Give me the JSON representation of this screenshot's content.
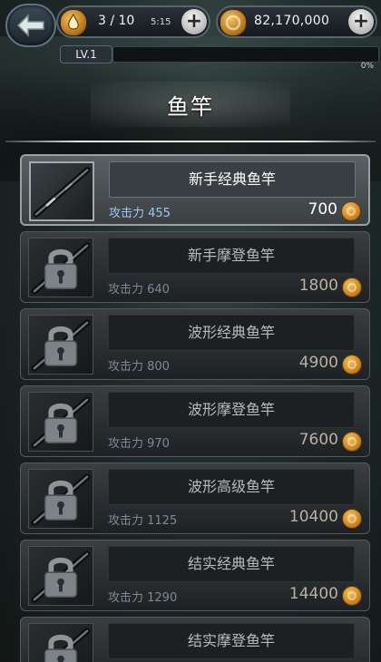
{
  "top_bar": {
    "energy": {
      "value": "3 / 10",
      "timer": "5:15",
      "icon": "flame-icon",
      "plus_icon": "plus-icon"
    },
    "coins": {
      "value": "82,170,000",
      "icon": "coin-icon",
      "plus_icon": "plus-icon"
    },
    "back_icon": "back-arrow-icon"
  },
  "level": {
    "label": "LV.1",
    "progress_percent": 0,
    "percent_text": "0%"
  },
  "page_title": "鱼竿",
  "rods": [
    {
      "name": "新手经典鱼竿",
      "attack": "攻击力 455",
      "price": "700",
      "locked": false
    },
    {
      "name": "新手摩登鱼竿",
      "attack": "攻击力 640",
      "price": "1800",
      "locked": true
    },
    {
      "name": "波形经典鱼竿",
      "attack": "攻击力 800",
      "price": "4900",
      "locked": true
    },
    {
      "name": "波形摩登鱼竿",
      "attack": "攻击力 970",
      "price": "7600",
      "locked": true
    },
    {
      "name": "波形高级鱼竿",
      "attack": "攻击力 1125",
      "price": "10400",
      "locked": true
    },
    {
      "name": "结实经典鱼竿",
      "attack": "攻击力 1290",
      "price": "14400",
      "locked": true
    },
    {
      "name": "结实摩登鱼竿",
      "attack": "",
      "price": "",
      "locked": true
    }
  ],
  "colors": {
    "accent_blue": "#9fc7f0",
    "coin_gold": "#c57a1a",
    "progress_green": "#2e8a4a"
  }
}
